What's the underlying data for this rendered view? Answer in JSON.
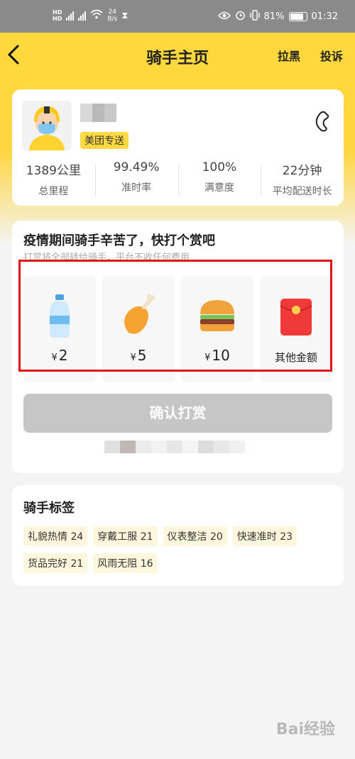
{
  "status_bar": {
    "net_speed_value": "24",
    "net_speed_unit": "B/s",
    "battery": "81%",
    "time": "01:32"
  },
  "nav": {
    "title": "骑手主页",
    "block": "拉黑",
    "report": "投诉"
  },
  "rider": {
    "badge": "美团专送",
    "stats": [
      {
        "value": "1389公里",
        "label": "总里程"
      },
      {
        "value": "99.49%",
        "label": "准时率"
      },
      {
        "value": "100%",
        "label": "满意度"
      },
      {
        "value": "22分钟",
        "label": "平均配送时长"
      }
    ]
  },
  "tip": {
    "title": "疫情期间骑手辛苦了，快打个赏吧",
    "subtitle": "打赏将全部转给骑手，平台不收任何费用",
    "currency": "¥",
    "options": [
      {
        "amount": "2",
        "icon": "water-bottle-icon"
      },
      {
        "amount": "5",
        "icon": "chicken-leg-icon"
      },
      {
        "amount": "10",
        "icon": "burger-icon"
      },
      {
        "label": "其他金额",
        "icon": "red-envelope-icon"
      }
    ],
    "confirm": "确认打赏"
  },
  "tags": {
    "title": "骑手标签",
    "items": [
      "礼貌热情 24",
      "穿戴工服 21",
      "仪表整洁 20",
      "快速准时 23",
      "货品完好 21",
      "风雨无阻 16"
    ]
  },
  "watermark": "Bai经验",
  "colors": {
    "brand_yellow": "#ffd93d",
    "highlight_red": "#e0151b",
    "disabled_button": "#c6c6c6"
  }
}
